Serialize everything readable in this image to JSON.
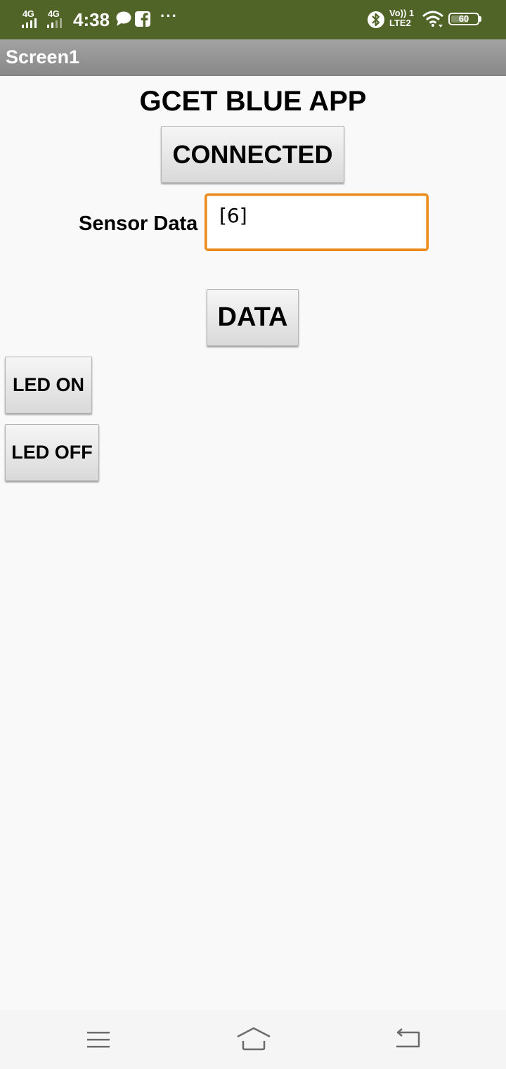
{
  "status_bar": {
    "signal1_label": "4G",
    "signal2_label": "4G",
    "time": "4:38",
    "more": "···",
    "volte_line1": "Vo)) 1",
    "volte_line2": "LTE2",
    "battery": "60",
    "icons": [
      "signal-icon",
      "chat-icon",
      "facebook-icon",
      "bluetooth-icon",
      "wifi-icon",
      "battery-icon"
    ],
    "background": "#506427"
  },
  "title_bar": {
    "title": "Screen1"
  },
  "main": {
    "app_title": "GCET BLUE APP",
    "connect_button": "CONNECTED",
    "sensor_label": "Sensor Data",
    "sensor_value": "[6]",
    "data_button": "DATA",
    "led_on_button": "LED ON",
    "led_off_button": "LED OFF",
    "accent_color": "#ec8a1a"
  },
  "nav_bar": {
    "icons": [
      "menu-icon",
      "home-icon",
      "back-icon"
    ]
  }
}
